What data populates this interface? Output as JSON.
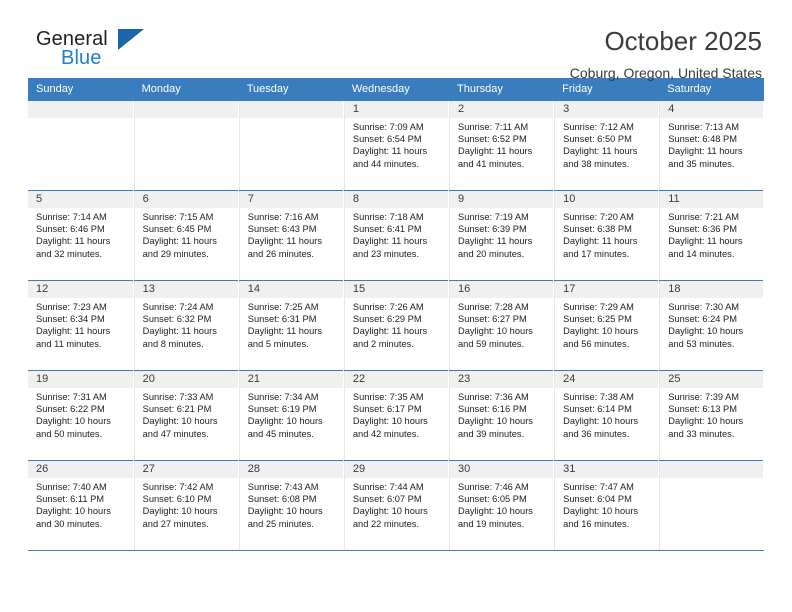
{
  "brand": {
    "name_top": "General",
    "name_bottom": "Blue",
    "triangle_icon": "blue-triangle-icon",
    "colors": {
      "dark": "#231f20",
      "blue": "#1f7fd0",
      "triangle": "#1c65a8"
    }
  },
  "header": {
    "title": "October 2025",
    "subtitle": "Coburg, Oregon, United States"
  },
  "theme": {
    "header_bg": "#3a7dbf",
    "daynum_bg": "#f0f0f0",
    "text": "#222222"
  },
  "calendar": {
    "weekday_headers": [
      "Sunday",
      "Monday",
      "Tuesday",
      "Wednesday",
      "Thursday",
      "Friday",
      "Saturday"
    ],
    "weeks": [
      [
        {
          "day": "",
          "empty": true,
          "sunrise": "",
          "sunset": "",
          "daylight_line1": "",
          "daylight_line2": ""
        },
        {
          "day": "",
          "empty": true,
          "sunrise": "",
          "sunset": "",
          "daylight_line1": "",
          "daylight_line2": ""
        },
        {
          "day": "",
          "empty": true,
          "sunrise": "",
          "sunset": "",
          "daylight_line1": "",
          "daylight_line2": ""
        },
        {
          "day": "1",
          "empty": false,
          "sunrise": "Sunrise: 7:09 AM",
          "sunset": "Sunset: 6:54 PM",
          "daylight_line1": "Daylight: 11 hours",
          "daylight_line2": "and 44 minutes."
        },
        {
          "day": "2",
          "empty": false,
          "sunrise": "Sunrise: 7:11 AM",
          "sunset": "Sunset: 6:52 PM",
          "daylight_line1": "Daylight: 11 hours",
          "daylight_line2": "and 41 minutes."
        },
        {
          "day": "3",
          "empty": false,
          "sunrise": "Sunrise: 7:12 AM",
          "sunset": "Sunset: 6:50 PM",
          "daylight_line1": "Daylight: 11 hours",
          "daylight_line2": "and 38 minutes."
        },
        {
          "day": "4",
          "empty": false,
          "sunrise": "Sunrise: 7:13 AM",
          "sunset": "Sunset: 6:48 PM",
          "daylight_line1": "Daylight: 11 hours",
          "daylight_line2": "and 35 minutes."
        }
      ],
      [
        {
          "day": "5",
          "empty": false,
          "sunrise": "Sunrise: 7:14 AM",
          "sunset": "Sunset: 6:46 PM",
          "daylight_line1": "Daylight: 11 hours",
          "daylight_line2": "and 32 minutes."
        },
        {
          "day": "6",
          "empty": false,
          "sunrise": "Sunrise: 7:15 AM",
          "sunset": "Sunset: 6:45 PM",
          "daylight_line1": "Daylight: 11 hours",
          "daylight_line2": "and 29 minutes."
        },
        {
          "day": "7",
          "empty": false,
          "sunrise": "Sunrise: 7:16 AM",
          "sunset": "Sunset: 6:43 PM",
          "daylight_line1": "Daylight: 11 hours",
          "daylight_line2": "and 26 minutes."
        },
        {
          "day": "8",
          "empty": false,
          "sunrise": "Sunrise: 7:18 AM",
          "sunset": "Sunset: 6:41 PM",
          "daylight_line1": "Daylight: 11 hours",
          "daylight_line2": "and 23 minutes."
        },
        {
          "day": "9",
          "empty": false,
          "sunrise": "Sunrise: 7:19 AM",
          "sunset": "Sunset: 6:39 PM",
          "daylight_line1": "Daylight: 11 hours",
          "daylight_line2": "and 20 minutes."
        },
        {
          "day": "10",
          "empty": false,
          "sunrise": "Sunrise: 7:20 AM",
          "sunset": "Sunset: 6:38 PM",
          "daylight_line1": "Daylight: 11 hours",
          "daylight_line2": "and 17 minutes."
        },
        {
          "day": "11",
          "empty": false,
          "sunrise": "Sunrise: 7:21 AM",
          "sunset": "Sunset: 6:36 PM",
          "daylight_line1": "Daylight: 11 hours",
          "daylight_line2": "and 14 minutes."
        }
      ],
      [
        {
          "day": "12",
          "empty": false,
          "sunrise": "Sunrise: 7:23 AM",
          "sunset": "Sunset: 6:34 PM",
          "daylight_line1": "Daylight: 11 hours",
          "daylight_line2": "and 11 minutes."
        },
        {
          "day": "13",
          "empty": false,
          "sunrise": "Sunrise: 7:24 AM",
          "sunset": "Sunset: 6:32 PM",
          "daylight_line1": "Daylight: 11 hours",
          "daylight_line2": "and 8 minutes."
        },
        {
          "day": "14",
          "empty": false,
          "sunrise": "Sunrise: 7:25 AM",
          "sunset": "Sunset: 6:31 PM",
          "daylight_line1": "Daylight: 11 hours",
          "daylight_line2": "and 5 minutes."
        },
        {
          "day": "15",
          "empty": false,
          "sunrise": "Sunrise: 7:26 AM",
          "sunset": "Sunset: 6:29 PM",
          "daylight_line1": "Daylight: 11 hours",
          "daylight_line2": "and 2 minutes."
        },
        {
          "day": "16",
          "empty": false,
          "sunrise": "Sunrise: 7:28 AM",
          "sunset": "Sunset: 6:27 PM",
          "daylight_line1": "Daylight: 10 hours",
          "daylight_line2": "and 59 minutes."
        },
        {
          "day": "17",
          "empty": false,
          "sunrise": "Sunrise: 7:29 AM",
          "sunset": "Sunset: 6:25 PM",
          "daylight_line1": "Daylight: 10 hours",
          "daylight_line2": "and 56 minutes."
        },
        {
          "day": "18",
          "empty": false,
          "sunrise": "Sunrise: 7:30 AM",
          "sunset": "Sunset: 6:24 PM",
          "daylight_line1": "Daylight: 10 hours",
          "daylight_line2": "and 53 minutes."
        }
      ],
      [
        {
          "day": "19",
          "empty": false,
          "sunrise": "Sunrise: 7:31 AM",
          "sunset": "Sunset: 6:22 PM",
          "daylight_line1": "Daylight: 10 hours",
          "daylight_line2": "and 50 minutes."
        },
        {
          "day": "20",
          "empty": false,
          "sunrise": "Sunrise: 7:33 AM",
          "sunset": "Sunset: 6:21 PM",
          "daylight_line1": "Daylight: 10 hours",
          "daylight_line2": "and 47 minutes."
        },
        {
          "day": "21",
          "empty": false,
          "sunrise": "Sunrise: 7:34 AM",
          "sunset": "Sunset: 6:19 PM",
          "daylight_line1": "Daylight: 10 hours",
          "daylight_line2": "and 45 minutes."
        },
        {
          "day": "22",
          "empty": false,
          "sunrise": "Sunrise: 7:35 AM",
          "sunset": "Sunset: 6:17 PM",
          "daylight_line1": "Daylight: 10 hours",
          "daylight_line2": "and 42 minutes."
        },
        {
          "day": "23",
          "empty": false,
          "sunrise": "Sunrise: 7:36 AM",
          "sunset": "Sunset: 6:16 PM",
          "daylight_line1": "Daylight: 10 hours",
          "daylight_line2": "and 39 minutes."
        },
        {
          "day": "24",
          "empty": false,
          "sunrise": "Sunrise: 7:38 AM",
          "sunset": "Sunset: 6:14 PM",
          "daylight_line1": "Daylight: 10 hours",
          "daylight_line2": "and 36 minutes."
        },
        {
          "day": "25",
          "empty": false,
          "sunrise": "Sunrise: 7:39 AM",
          "sunset": "Sunset: 6:13 PM",
          "daylight_line1": "Daylight: 10 hours",
          "daylight_line2": "and 33 minutes."
        }
      ],
      [
        {
          "day": "26",
          "empty": false,
          "sunrise": "Sunrise: 7:40 AM",
          "sunset": "Sunset: 6:11 PM",
          "daylight_line1": "Daylight: 10 hours",
          "daylight_line2": "and 30 minutes."
        },
        {
          "day": "27",
          "empty": false,
          "sunrise": "Sunrise: 7:42 AM",
          "sunset": "Sunset: 6:10 PM",
          "daylight_line1": "Daylight: 10 hours",
          "daylight_line2": "and 27 minutes."
        },
        {
          "day": "28",
          "empty": false,
          "sunrise": "Sunrise: 7:43 AM",
          "sunset": "Sunset: 6:08 PM",
          "daylight_line1": "Daylight: 10 hours",
          "daylight_line2": "and 25 minutes."
        },
        {
          "day": "29",
          "empty": false,
          "sunrise": "Sunrise: 7:44 AM",
          "sunset": "Sunset: 6:07 PM",
          "daylight_line1": "Daylight: 10 hours",
          "daylight_line2": "and 22 minutes."
        },
        {
          "day": "30",
          "empty": false,
          "sunrise": "Sunrise: 7:46 AM",
          "sunset": "Sunset: 6:05 PM",
          "daylight_line1": "Daylight: 10 hours",
          "daylight_line2": "and 19 minutes."
        },
        {
          "day": "31",
          "empty": false,
          "sunrise": "Sunrise: 7:47 AM",
          "sunset": "Sunset: 6:04 PM",
          "daylight_line1": "Daylight: 10 hours",
          "daylight_line2": "and 16 minutes."
        },
        {
          "day": "",
          "empty": true,
          "sunrise": "",
          "sunset": "",
          "daylight_line1": "",
          "daylight_line2": ""
        }
      ]
    ]
  }
}
